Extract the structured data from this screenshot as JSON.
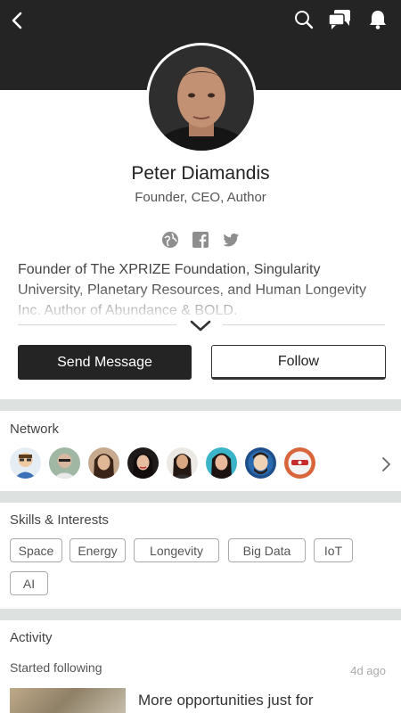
{
  "header": {
    "back_icon": "chevron-left-icon",
    "search_icon": "search-icon",
    "messages_icon": "chat-bubbles-icon",
    "notifications_icon": "bell-icon"
  },
  "profile": {
    "name": "Peter Diamandis",
    "title": "Founder, CEO, Author",
    "social_icons": [
      "globe-icon",
      "facebook-icon",
      "twitter-icon"
    ],
    "bio": "Founder of The XPRIZE Foundation, Singularity University, Planetary Resources, and Human Longevity Inc. Author of Abundance & BOLD."
  },
  "actions": {
    "send_message_label": "Send Message",
    "follow_label": "Follow"
  },
  "network": {
    "title": "Network"
  },
  "skills": {
    "title": "Skills & Interests",
    "tags": [
      "Space",
      "Energy",
      "Longevity",
      "Big Data",
      "IoT",
      "AI"
    ]
  },
  "activity": {
    "title": "Activity",
    "item_label": "Started following",
    "item_time": "4d ago",
    "item_text": "More opportunities just for"
  },
  "colors": {
    "header_bg": "#242424",
    "separator": "#dde1e0",
    "primary_button": "#242424"
  }
}
